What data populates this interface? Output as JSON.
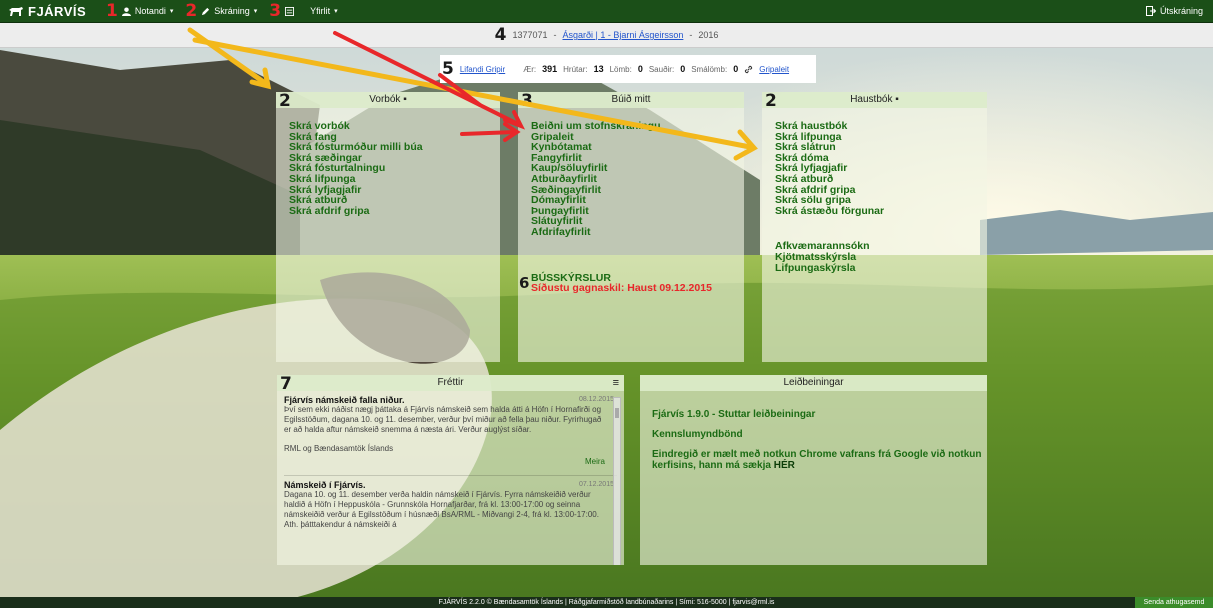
{
  "navbar": {
    "brand": "FJÁRVÍS",
    "items": [
      {
        "num": "1",
        "label": "Notandi"
      },
      {
        "num": "2",
        "label": "Skráning"
      },
      {
        "num": "3",
        "label": "Yfirlit"
      }
    ],
    "logout": "Útskráning"
  },
  "breadcrumb": {
    "num": "4",
    "id": "1377071",
    "link": "Ásgarði | 1 - Bjarni Ásgeirsson",
    "year": "2016"
  },
  "stats": {
    "num": "5",
    "link": "Lifandi Gripir",
    "items": [
      {
        "label": "Ær:",
        "value": "391"
      },
      {
        "label": "Hrútar:",
        "value": "13"
      },
      {
        "label": "Lömb:",
        "value": "0"
      },
      {
        "label": "Sauðir:",
        "value": "0"
      },
      {
        "label": "Smálömb:",
        "value": "0"
      }
    ],
    "gripaleit": "Gripaleit"
  },
  "vorbok": {
    "num": "2",
    "title": "Vorbók",
    "links": [
      "Skrá vorbók",
      "Skrá fang",
      "Skrá fósturmóður milli búa",
      "Skrá sæðingar",
      "Skrá fósturtalningu",
      "Skrá lifpunga",
      "Skrá lyfjagjafir",
      "Skrá atburð",
      "Skrá afdrif gripa"
    ]
  },
  "bulo": {
    "num": "3",
    "title": "Búið mitt",
    "links": [
      "Beiðni um stofnskráningu",
      "Gripaleit",
      "Kynbótamat",
      "Fangyfirlit",
      "Kaup/söluyfirlit",
      "Atburðayfirlit",
      "Sæðingayfirlit",
      "Dómayfirlit",
      "Þungayfirlit",
      "Slátuyfirlit",
      "Afdrifayfirlit"
    ],
    "reports_num": "6",
    "reports_title": "BÚSSKÝRSLUR",
    "reports_last": "Síðustu gagnaskil: Haust 09.12.2015"
  },
  "haustbok": {
    "num": "2",
    "title": "Haustbók",
    "links": [
      "Skrá haustbók",
      "Skrá lifpunga",
      "Skrá slátrun",
      "Skrá dóma",
      "Skrá lyfjagjafir",
      "Skrá atburð",
      "Skrá afdrif gripa",
      "Skrá sölu gripa",
      "Skrá ástæðu förgunar"
    ],
    "reports": [
      "Afkvæmarannsókn",
      "Kjötmatsskýrsla",
      "Lifpungaskýrsla"
    ]
  },
  "frettir": {
    "num": "7",
    "title": "Fréttir",
    "items": [
      {
        "date": "08.12.2015",
        "title": "Fjárvís námskeið falla niður.",
        "body": "Því sem ekki náðist nægj þáttaka á Fjárvís námskeið sem halda átti á Höfn í Hornafirði og Egilsstöðum, dagana 10. og 11. desember, verður því miður að fella þau niður. Fyrirhugað er að halda aftur námskeið snemma á næsta ári. Verður auglýst síðar.",
        "sign": "RML og Bændasamtök Íslands",
        "more": "Meira"
      },
      {
        "date": "07.12.2015",
        "title": "Námskeið í Fjárvís.",
        "body": "Dagana 10. og 11. desember verða haldin námskeið í Fjárvís. Fyrra námskeiðið verður haldið á Höfn í Heppuskóla - Grunnskóla Hornafjarðar, frá kl. 13:00-17:00 og seinna námskeiðið verður á Egilsstöðum í húsnæði BsA/RML - Miðvangi 2-4, frá kl. 13:00-17:00. Ath. þátttakendur á námskeiði á"
      }
    ]
  },
  "leidbeiningar": {
    "title": "Leiðbeiningar",
    "link1": "Fjárvís 1.9.0 - Stuttar leiðbeiningar",
    "link2": "Kennslumyndbönd",
    "note": "Eindregið er mælt með notkun Chrome vafrans frá Google við notkun kerfisins, hann má sækja",
    "note_link": "HÉR"
  },
  "footer": {
    "text": "FJÁRVÍS 2.2.0 © Bændasamtök Íslands | Ráðgjafarmiðstöð landbúnaðarins | Sími: 516-5000 | fjarvis@rml.is",
    "button": "Senda athugasemd"
  },
  "colors": {
    "nav": "#1b4f18",
    "link_green": "#1b6b14",
    "annotation_red": "#e8272a",
    "annotation_yellow": "#f3b81b"
  }
}
